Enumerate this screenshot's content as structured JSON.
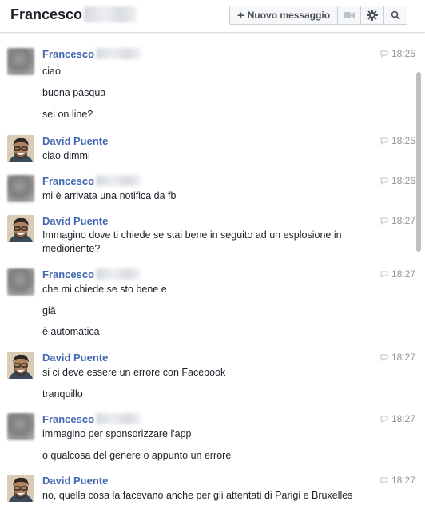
{
  "header": {
    "title": "Francesco",
    "new_message_label": "Nuovo messaggio"
  },
  "messages": [
    {
      "sender": "Francesco",
      "time": "18:25",
      "lines": [
        "ciao",
        "buona pasqua",
        "sei on line?"
      ]
    },
    {
      "sender": "David Puente",
      "time": "18:25",
      "lines": [
        "ciao dimmi"
      ]
    },
    {
      "sender": "Francesco",
      "time": "18:26",
      "lines": [
        "mi è arrivata una notifica da fb"
      ]
    },
    {
      "sender": "David Puente",
      "time": "18:27",
      "lines": [
        "Immagino dove ti chiede se stai bene in seguito ad un esplosione in medioriente?"
      ]
    },
    {
      "sender": "Francesco",
      "time": "18:27",
      "lines": [
        "che mi chiede se sto bene e",
        "già",
        "è automatica"
      ]
    },
    {
      "sender": "David Puente",
      "time": "18:27",
      "lines": [
        "si ci deve essere un errore con Facebook",
        "tranquillo"
      ]
    },
    {
      "sender": "Francesco",
      "time": "18:27",
      "lines": [
        "immagino per sponsorizzare l'app",
        "o qualcosa del genere o appunto un errore"
      ]
    },
    {
      "sender": "David Puente",
      "time": "18:27",
      "lines": [
        "no, quella cosa la facevano anche per gli attentati di Parigi e Bruxelles"
      ]
    }
  ]
}
